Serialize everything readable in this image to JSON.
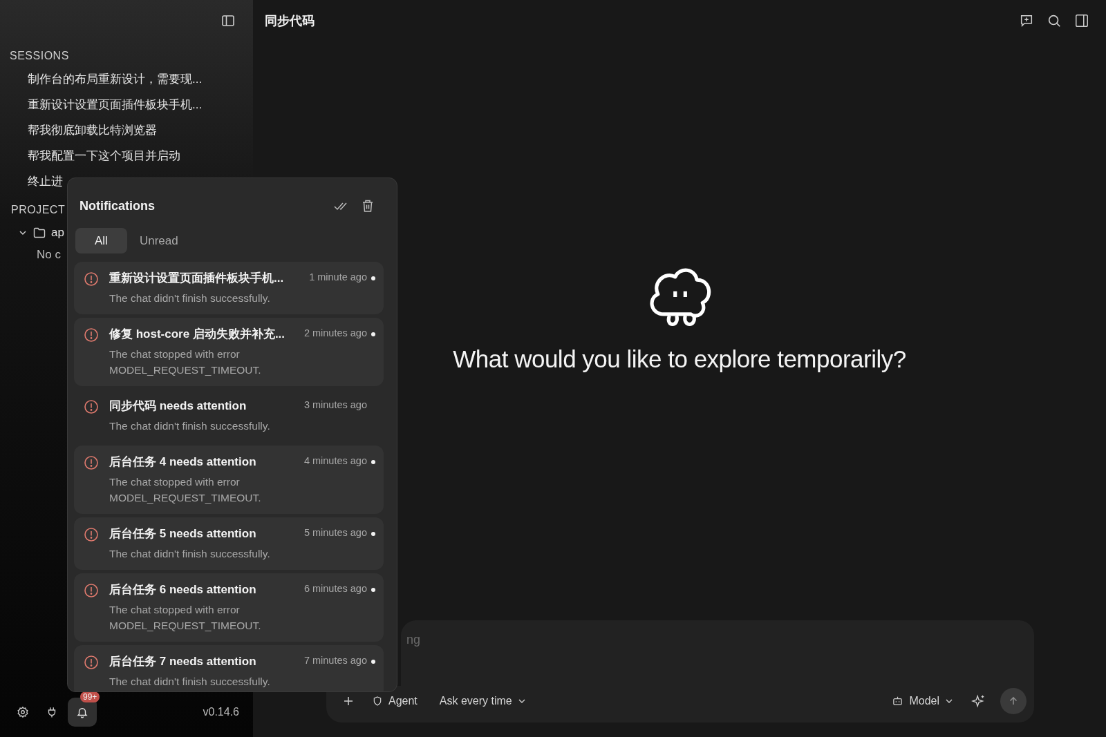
{
  "top_bar": {
    "title": "同步代码"
  },
  "sidebar": {
    "sessions_label": "SESSIONS",
    "sessions": [
      {
        "title": "制作台的布局重新设计，需要现..."
      },
      {
        "title": "重新设计设置页面插件板块手机..."
      },
      {
        "title": "帮我彻底卸载比特浏览器"
      },
      {
        "title": "帮我配置一下这个项目并启动"
      },
      {
        "title": "终止进"
      }
    ],
    "projects_label": "PROJECT",
    "projects": [
      {
        "name": "ap",
        "expanded": true,
        "empty_text": "No c"
      }
    ],
    "notification_badge": "99+",
    "version": "v0.14.6"
  },
  "notifications": {
    "title": "Notifications",
    "tabs": [
      {
        "label": "All",
        "selected": true
      },
      {
        "label": "Unread",
        "selected": false
      }
    ],
    "items": [
      {
        "title": "重新设计设置页面插件板块手机...",
        "time": "1 minute ago",
        "message": "The chat didn't finish successfully.",
        "unread": true
      },
      {
        "title": "修复 host-core 启动失败并补充...",
        "time": "2 minutes ago",
        "message": "The chat stopped with error MODEL_REQUEST_TIMEOUT.",
        "unread": true
      },
      {
        "title": "同步代码 needs attention",
        "time": "3 minutes ago",
        "message": "The chat didn't finish successfully.",
        "unread": false
      },
      {
        "title": "后台任务 4 needs attention",
        "time": "4 minutes ago",
        "message": "The chat stopped with error MODEL_REQUEST_TIMEOUT.",
        "unread": true
      },
      {
        "title": "后台任务 5 needs attention",
        "time": "5 minutes ago",
        "message": "The chat didn't finish successfully.",
        "unread": true
      },
      {
        "title": "后台任务 6 needs attention",
        "time": "6 minutes ago",
        "message": "The chat stopped with error MODEL_REQUEST_TIMEOUT.",
        "unread": true
      },
      {
        "title": "后台任务 7 needs attention",
        "time": "7 minutes ago",
        "message": "The chat didn't finish successfully.",
        "unread": true
      }
    ]
  },
  "main": {
    "heading": "What would you like to explore temporarily?"
  },
  "composer": {
    "placeholder": "ng",
    "mode": "Agent",
    "permission": "Ask every time",
    "model": "Model"
  }
}
